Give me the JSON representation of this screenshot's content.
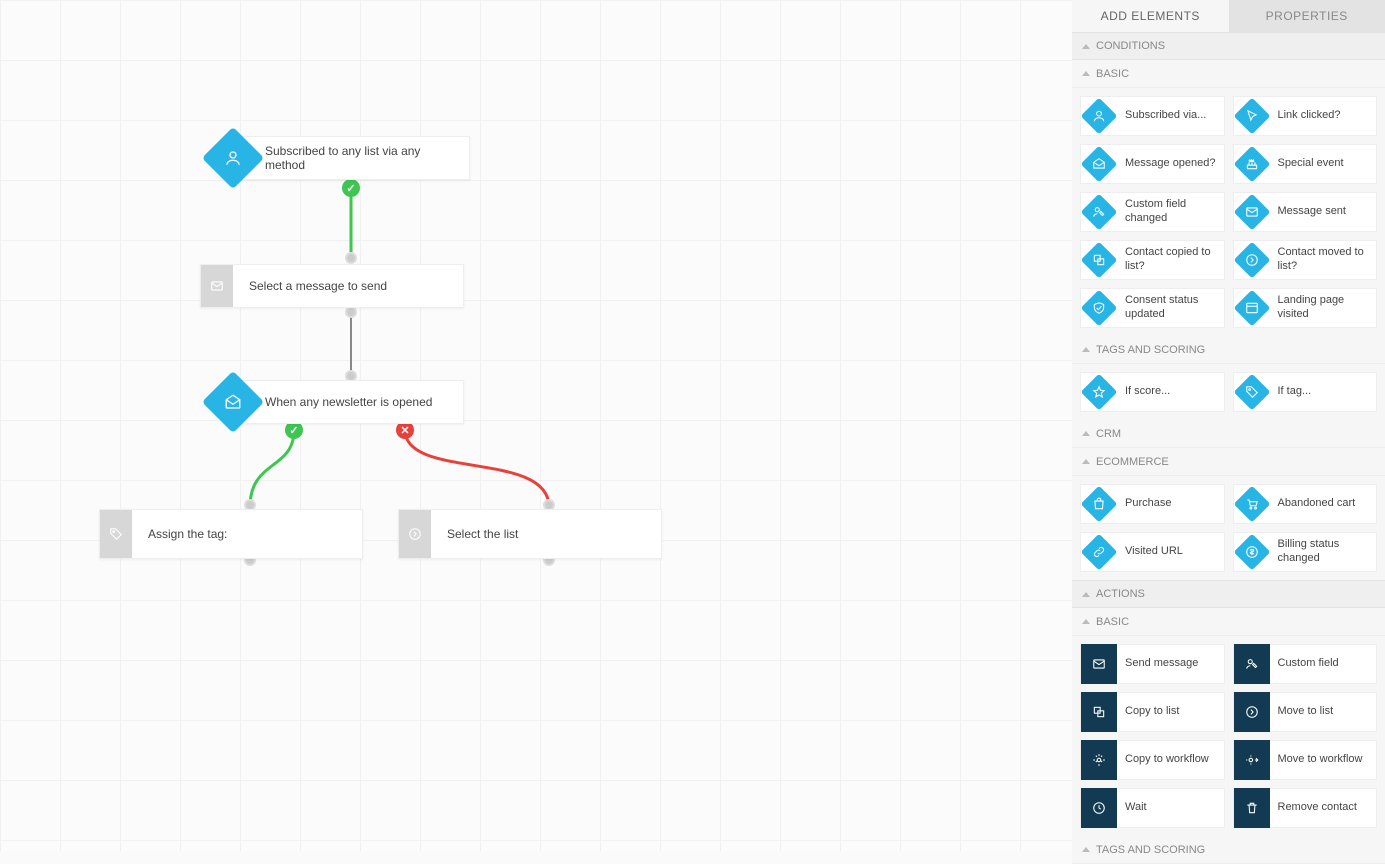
{
  "canvas": {
    "nodes": {
      "n1": {
        "label": "Subscribed to any list via any method"
      },
      "n2": {
        "label": "Select a message to send"
      },
      "n3": {
        "label": "When any newsletter is opened"
      },
      "n4": {
        "label": "Assign the tag:"
      },
      "n5": {
        "label": "Select the list"
      }
    }
  },
  "sidebar": {
    "tabs": {
      "add": "ADD ELEMENTS",
      "props": "PROPERTIES"
    },
    "sections": {
      "conditions": {
        "title": "CONDITIONS",
        "groups": {
          "basic": {
            "title": "BASIC",
            "items": [
              "Subscribed via...",
              "Link clicked?",
              "Message opened?",
              "Special event",
              "Custom field changed",
              "Message sent",
              "Contact copied to list?",
              "Contact moved to list?",
              "Consent status updated",
              "Landing page visited"
            ]
          },
          "tags": {
            "title": "TAGS AND SCORING",
            "items": [
              "If score...",
              "If tag..."
            ]
          },
          "crm": {
            "title": "CRM"
          },
          "ecom": {
            "title": "ECOMMERCE",
            "items": [
              "Purchase",
              "Abandoned cart",
              "Visited URL",
              "Billing status changed"
            ]
          }
        }
      },
      "actions": {
        "title": "ACTIONS",
        "groups": {
          "basic": {
            "title": "BASIC",
            "items": [
              "Send message",
              "Custom field",
              "Copy to list",
              "Move to list",
              "Copy to workflow",
              "Move to workflow",
              "Wait",
              "Remove contact"
            ]
          },
          "tags": {
            "title": "TAGS AND SCORING"
          }
        }
      }
    }
  }
}
